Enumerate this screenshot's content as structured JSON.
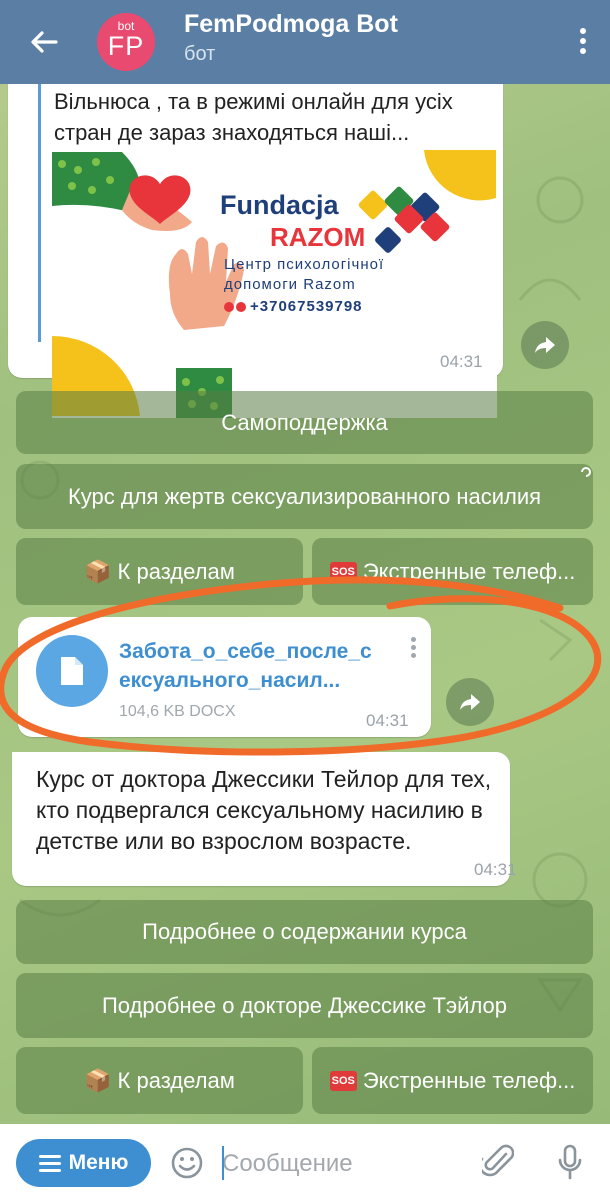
{
  "header": {
    "avatar_small": "bot",
    "avatar_initials": "FP",
    "title": "FemPodmoga Bot",
    "subtitle": "бот"
  },
  "messages": {
    "preview_text": "Вільнюса , та в режимі онлайн для усіх стран де зараз знаходяться наші...",
    "promo": {
      "org_line1": "Fundacja",
      "org_line2": "RAZOM",
      "desc_line1": "Центр психологічної",
      "desc_line2": "допомоги Razom",
      "phone": "+37067539798"
    },
    "preview_time": "04:31",
    "file": {
      "name": "Забота_о_себе_после_сексуального_насил...",
      "name_line1": "Забота_о_себе_после_с",
      "name_line2": "ексуального_насил...",
      "meta": "104,6 KB DOCX",
      "time": "04:31"
    },
    "course_text": "Курс от доктора Джессики Тейлор для тех, кто подвергался сексуальному насилию в детстве или во взрослом возрасте.",
    "course_time": "04:31"
  },
  "keyboard1": {
    "self_support": "Самоподдержка",
    "course_victims": "Курс для жертв сексуализированного насилия",
    "to_sections": "К разделам",
    "emergency": "Экстренные телеф..."
  },
  "keyboard2": {
    "course_details": "Подробнее о содержании курса",
    "doctor_details": "Подробнее о докторе Джессике Тэйлор",
    "to_sections": "К разделам",
    "emergency": "Экстренные телеф..."
  },
  "badges": {
    "sos": "SOS"
  },
  "input": {
    "menu_label": "Меню",
    "placeholder": "Сообщение"
  },
  "colors": {
    "header_bg": "#5b7fa4",
    "avatar_bg": "#e94a6f",
    "accent": "#3d8fd1",
    "annotation": "#f06a2a"
  },
  "icons": [
    "back-arrow-icon",
    "kebab-menu-icon",
    "forward-icon",
    "document-icon",
    "box-emoji-icon",
    "sos-emoji-icon",
    "emoji-icon",
    "attach-icon",
    "microphone-icon",
    "menu-lines-icon"
  ]
}
